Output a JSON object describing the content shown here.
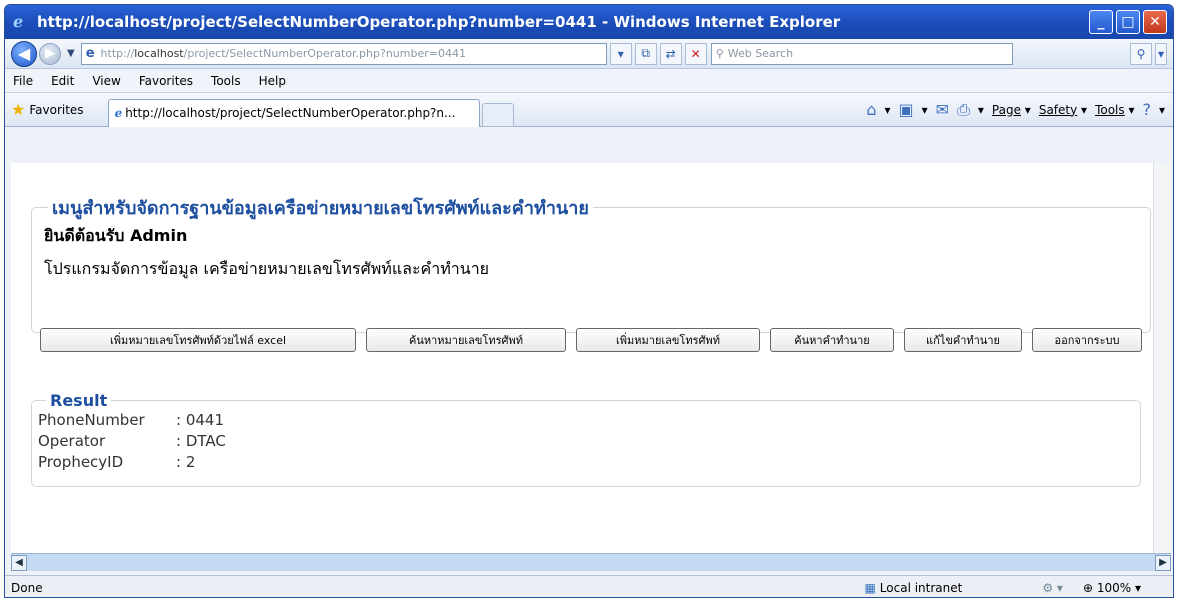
{
  "window": {
    "title": "http://localhost/project/SelectNumberOperator.php?number=0441 - Windows Internet Explorer"
  },
  "address": {
    "prefix": "http://",
    "host": "localhost",
    "path": "/project/SelectNumberOperator.php?number=0441"
  },
  "search": {
    "placeholder": "Web Search"
  },
  "menu": {
    "file": "File",
    "edit": "Edit",
    "view": "View",
    "favorites": "Favorites",
    "tools": "Tools",
    "help": "Help"
  },
  "favbar": {
    "favorites_label": "Favorites",
    "tab_title": "http://localhost/project/SelectNumberOperator.php?n...",
    "page_label": "Page",
    "safety_label": "Safety",
    "tools_label": "Tools"
  },
  "page": {
    "legend": "เมนูสำหรับจัดการฐานข้อมูลเครือข่ายหมายเลขโทรศัพท์และคำทำนาย",
    "welcome": "ยินดีต้อนรับ Admin",
    "subtitle": "โปรแกรมจัดการข้อมูล เครือข่ายหมายเลขโทรศัพท์และคำทำนาย",
    "buttons": [
      "เพิ่มหมายเลขโทรศัพท์ด้วยไฟล์ excel",
      "ค้นหาหมายเลขโทรศัพท์",
      "เพิ่มหมายเลขโทรศัพท์",
      "ค้นหาคำทำนาย",
      "แก้ไขคำทำนาย",
      "ออกจากระบบ"
    ],
    "result": {
      "legend": "Result",
      "rows": [
        {
          "key": "PhoneNumber",
          "value": ": 0441"
        },
        {
          "key": "Operator",
          "value": ": DTAC"
        },
        {
          "key": "ProphecyID",
          "value": ": 2"
        }
      ]
    }
  },
  "status": {
    "text": "Done",
    "zone": "Local intranet",
    "zoom": "100%"
  }
}
